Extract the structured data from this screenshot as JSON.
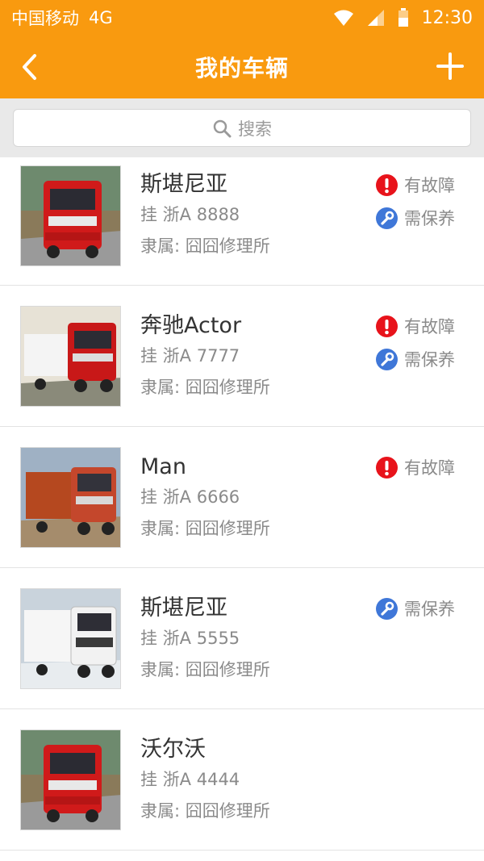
{
  "status_bar": {
    "carrier": "中国移动",
    "network": "4G",
    "time": "12:30"
  },
  "nav": {
    "title": "我的车辆"
  },
  "search": {
    "placeholder": "搜索"
  },
  "vehicles": [
    {
      "name": "斯堪尼亚",
      "plate": "挂 浙A 8888",
      "owner": "隶属: 囧囧修理所",
      "status_fault": "有故障",
      "status_maintenance": "需保养"
    },
    {
      "name": "奔驰Actor",
      "plate": "挂 浙A 7777",
      "owner": "隶属: 囧囧修理所",
      "status_fault": "有故障",
      "status_maintenance": "需保养"
    },
    {
      "name": "Man",
      "plate": "挂 浙A 6666",
      "owner": "隶属: 囧囧修理所",
      "status_fault": "有故障"
    },
    {
      "name": "斯堪尼亚",
      "plate": "挂 浙A 5555",
      "owner": "隶属: 囧囧修理所",
      "status_maintenance": "需保养"
    },
    {
      "name": "沃尔沃",
      "plate": "挂 浙A 4444",
      "owner": "隶属: 囧囧修理所"
    }
  ],
  "colors": {
    "header": "#f99a0f",
    "fault": "#e8131b",
    "maintenance": "#3f77d8"
  },
  "icons": {
    "back": "chevron-left-icon",
    "add": "plus-icon",
    "search": "search-icon",
    "fault": "exclamation-icon",
    "maintenance": "wrench-icon",
    "wifi": "wifi-icon",
    "signal": "signal-icon",
    "battery": "battery-icon"
  }
}
